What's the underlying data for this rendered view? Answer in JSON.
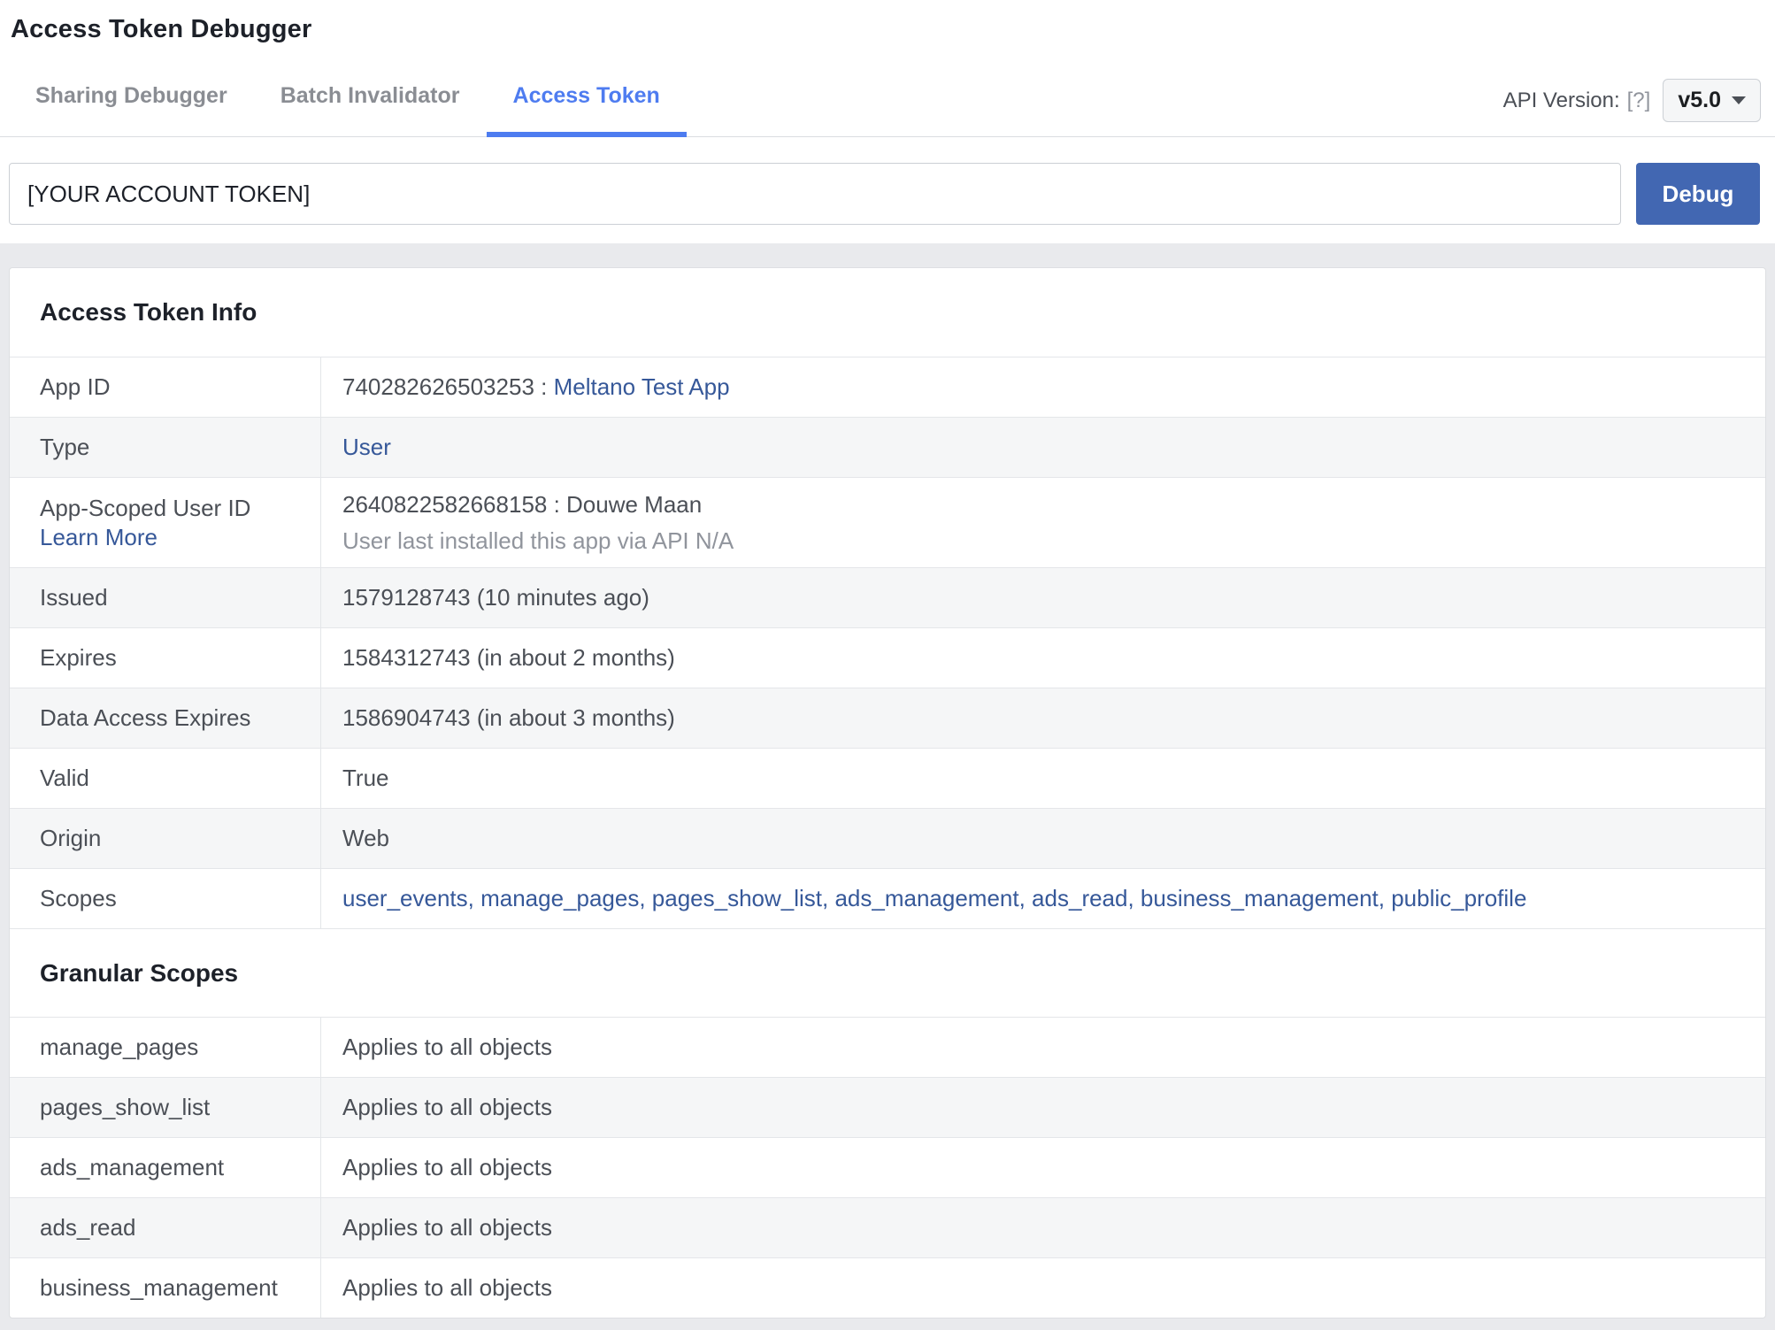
{
  "header": {
    "title": "Access Token Debugger",
    "tabs": [
      {
        "label": "Sharing Debugger"
      },
      {
        "label": "Batch Invalidator"
      },
      {
        "label": "Access Token"
      }
    ],
    "api_version": {
      "label": "API Version:",
      "help": "[?]",
      "value": "v5.0"
    }
  },
  "form": {
    "token_input": "[YOUR ACCOUNT TOKEN]",
    "debug_button": "Debug"
  },
  "token_info": {
    "title": "Access Token Info",
    "rows": {
      "app_id": {
        "label": "App ID",
        "value": "740282626503253 : ",
        "link": "Meltano Test App"
      },
      "type": {
        "label": "Type",
        "link": "User"
      },
      "app_scoped_user_id": {
        "label": "App-Scoped User ID",
        "label_link": "Learn More",
        "value": "2640822582668158 : Douwe Maan",
        "note": "User last installed this app via API N/A"
      },
      "issued": {
        "label": "Issued",
        "value": "1579128743 (10 minutes ago)"
      },
      "expires": {
        "label": "Expires",
        "value": "1584312743 (in about 2 months)"
      },
      "data_access_expires": {
        "label": "Data Access Expires",
        "value": "1586904743 (in about 3 months)"
      },
      "valid": {
        "label": "Valid",
        "value": "True"
      },
      "origin": {
        "label": "Origin",
        "value": "Web"
      },
      "scopes": {
        "label": "Scopes",
        "link": "user_events, manage_pages, pages_show_list, ads_management, ads_read, business_management, public_profile"
      }
    }
  },
  "granular_scopes": {
    "title": "Granular Scopes",
    "rows": [
      {
        "label": "manage_pages",
        "value": "Applies to all objects"
      },
      {
        "label": "pages_show_list",
        "value": "Applies to all objects"
      },
      {
        "label": "ads_management",
        "value": "Applies to all objects"
      },
      {
        "label": "ads_read",
        "value": "Applies to all objects"
      },
      {
        "label": "business_management",
        "value": "Applies to all objects"
      }
    ]
  },
  "colors": {
    "debug_button_blue": "#4267b2",
    "active_tab_blue": "#4d7cf0",
    "link_blue": "#365899",
    "page_background": "#e9eaed",
    "alt_row_background": "#f5f6f7"
  }
}
